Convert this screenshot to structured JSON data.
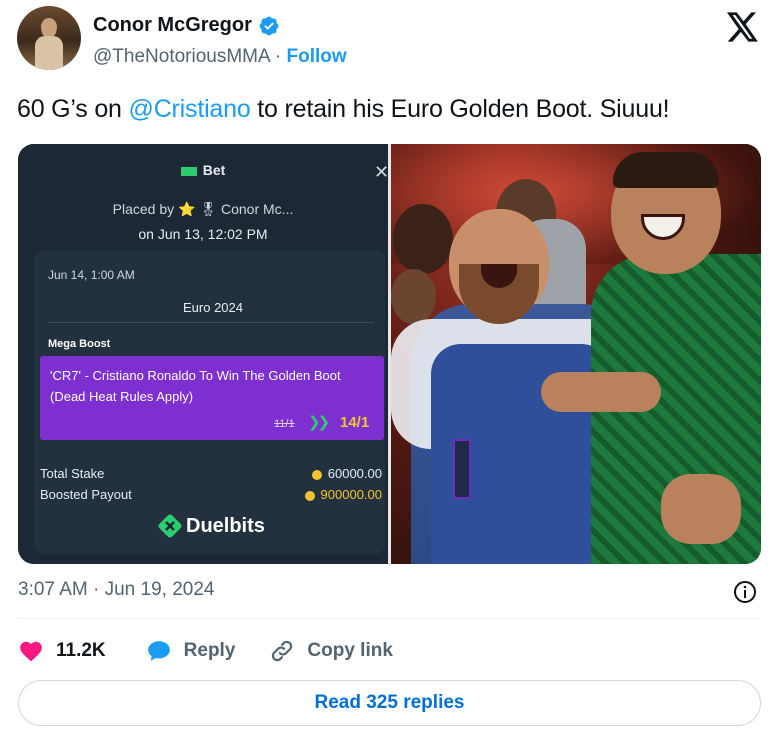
{
  "author": {
    "display_name": "Conor McGregor",
    "handle": "@TheNotoriousMMA",
    "separator": "·",
    "follow_label": "Follow"
  },
  "tweet": {
    "text_before": "60 G’s on ",
    "mention": "@Cristiano",
    "text_after": " to retain his Euro Golden Boot. Siuuu!"
  },
  "bet_slip": {
    "title": "Bet",
    "close": "✕",
    "placed_by": "Placed by ⭐ 🎖 Conor Mc...",
    "placed_on": "on Jun 13, 12:02 PM",
    "event_date": "Jun 14, 1:00 AM",
    "event_name": "Euro 2024",
    "boost_label": "Mega Boost",
    "selection_line1": "'CR7' - Cristiano Ronaldo To Win The Golden Boot",
    "selection_line2": "(Dead Heat Rules Apply)",
    "old_odds": "11/1",
    "new_odds": "14/1",
    "total_stake_label": "Total Stake",
    "total_stake_value": "60000.00",
    "boosted_payout_label": "Boosted Payout",
    "boosted_payout_value": "900000.00",
    "brand": "Duelbits"
  },
  "meta": {
    "time_date": "3:07 AM · Jun 19, 2024"
  },
  "actions": {
    "likes": "11.2K",
    "reply_label": "Reply",
    "copy_link_label": "Copy link"
  },
  "read_replies_label": "Read 325 replies",
  "colors": {
    "accent": "#1d9bf0",
    "like": "#f91880",
    "boost_purple": "#7d2fd0",
    "slip_bg": "#1c2833"
  }
}
